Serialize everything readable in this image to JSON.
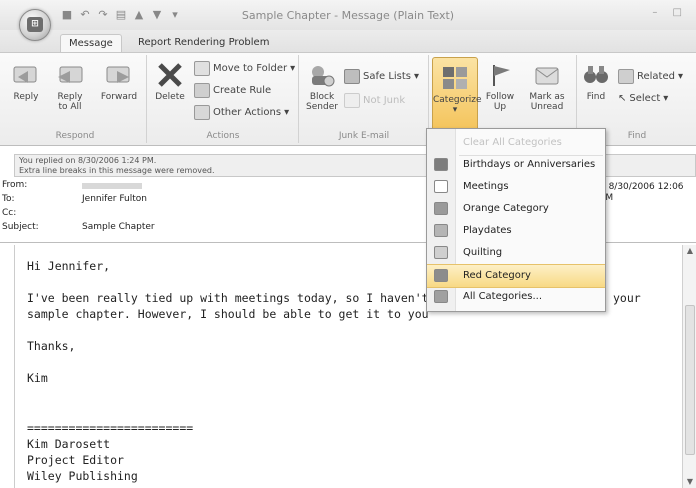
{
  "window": {
    "title": "Sample Chapter - Message (Plain Text)",
    "office_button_glyph": "⊞"
  },
  "tabs": [
    "Message",
    "Report Rendering Problem"
  ],
  "ribbon": {
    "respond": {
      "label": "Respond",
      "reply": "Reply",
      "reply_all_1": "Reply",
      "reply_all_2": "to All",
      "forward": "Forward"
    },
    "actions": {
      "label": "Actions",
      "delete": "Delete",
      "move_to_folder": "Move to Folder",
      "create_rule": "Create Rule",
      "other_actions": "Other Actions"
    },
    "junk": {
      "label": "Junk E-mail",
      "block_1": "Block",
      "block_2": "Sender",
      "safe_lists": "Safe Lists",
      "not_junk": "Not Junk"
    },
    "options": {
      "categorize": "Categorize",
      "follow_1": "Follow",
      "follow_2": "Up",
      "mark_1": "Mark as",
      "mark_2": "Unread"
    },
    "find": {
      "label": "Find",
      "find": "Find",
      "related": "Related",
      "select": "Select"
    }
  },
  "infobar": {
    "line1": "You replied on 8/30/2006 1:24 PM.",
    "line2": "Extra line breaks in this message were removed."
  },
  "header": {
    "from_label": "From:",
    "to_label": "To:",
    "to_value": "Jennifer Fulton",
    "cc_label": "Cc:",
    "subject_label": "Subject:",
    "subject_value": "Sample Chapter",
    "sent": "d 8/30/2006 12:06 PM"
  },
  "body_lines": [
    "Hi Jennifer,",
    "I've been really tied up with meetings today, so I haven't",
    "your",
    "sample chapter. However, I should be able to get it to you",
    "Thanks,",
    "Kim",
    "========================",
    "Kim Darosett",
    "Project Editor",
    "Wiley Publishing"
  ],
  "category_menu": {
    "clear_all": "Clear All Categories",
    "items": [
      {
        "label": "Birthdays or Anniversaries",
        "color": "#7d7d7d"
      },
      {
        "label": "Meetings",
        "color": "#ffffff"
      },
      {
        "label": "Orange Category",
        "color": "#9a9a9a"
      },
      {
        "label": "Playdates",
        "color": "#b5b5b5"
      },
      {
        "label": "Quilting",
        "color": "#cfcfcf"
      },
      {
        "label": "Red Category",
        "color": "#8c8c8c"
      }
    ],
    "all_categories": "All Categories..."
  },
  "colors": {
    "accent_hover": "#f8d984",
    "ribbon_bg": "#ececec"
  }
}
